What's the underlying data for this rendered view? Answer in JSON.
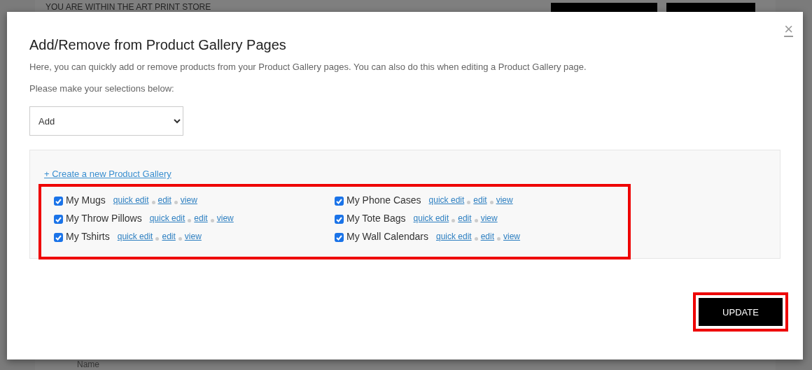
{
  "background": {
    "store_notice": "YOU ARE WITHIN THE ART PRINT STORE",
    "field_label": "Name"
  },
  "dialog": {
    "title": "Add/Remove from Product Gallery Pages",
    "close": "×",
    "description": "Here, you can quickly add or remove products from your Product Gallery pages. You can also do this when editing a Product Gallery page.",
    "prompt": "Please make your selections below:",
    "action_select": {
      "value": "Add"
    },
    "create_link": "+ Create a new Product Gallery",
    "galleries_highlighted": true,
    "galleries": [
      {
        "name": "My Mugs",
        "checked": true,
        "links": [
          "quick edit",
          "edit",
          "view"
        ]
      },
      {
        "name": "My Throw Pillows",
        "checked": true,
        "links": [
          "quick edit",
          "edit",
          "view"
        ]
      },
      {
        "name": "My Tshirts",
        "checked": true,
        "links": [
          "quick edit",
          "edit",
          "view"
        ]
      },
      {
        "name": "My Phone Cases",
        "checked": true,
        "links": [
          "quick edit",
          "edit",
          "view"
        ]
      },
      {
        "name": "My Tote Bags",
        "checked": true,
        "links": [
          "quick edit",
          "edit",
          "view"
        ]
      },
      {
        "name": "My Wall Calendars",
        "checked": true,
        "links": [
          "quick edit",
          "edit",
          "view"
        ]
      }
    ],
    "update_button": {
      "label": "UPDATE",
      "highlighted": true
    }
  }
}
